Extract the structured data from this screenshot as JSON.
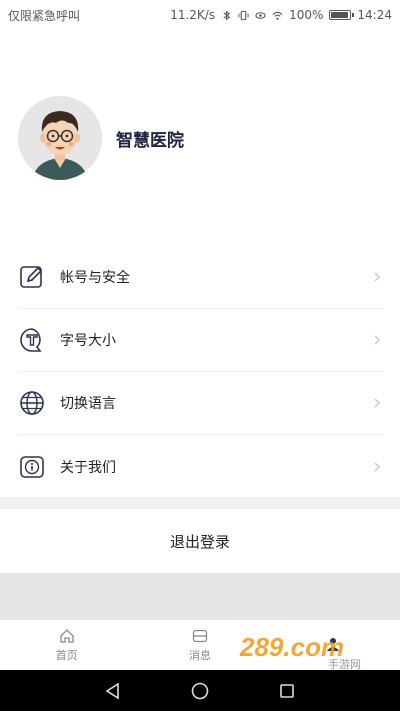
{
  "status_bar": {
    "left_text": "仅限紧急呼叫",
    "net_speed": "11.2K/s",
    "battery_text": "100%",
    "battery_level": 1.0,
    "time": "14:24"
  },
  "profile": {
    "name": "智慧医院"
  },
  "menu": {
    "items": [
      {
        "label": "帐号与安全",
        "icon": "edit-icon"
      },
      {
        "label": "字号大小",
        "icon": "font-size-icon"
      },
      {
        "label": "切换语言",
        "icon": "globe-icon"
      },
      {
        "label": "关于我们",
        "icon": "info-icon"
      }
    ]
  },
  "logout_label": "退出登录",
  "tabs": [
    {
      "label": "首页",
      "icon": "home-icon"
    },
    {
      "label": "消息",
      "icon": "message-icon"
    },
    {
      "label": "",
      "icon": "profile-icon"
    }
  ],
  "watermark": {
    "text": "289.com",
    "sub": "手游网"
  },
  "colors": {
    "accent": "#1f2340",
    "watermark_orange": "#f29a12"
  }
}
